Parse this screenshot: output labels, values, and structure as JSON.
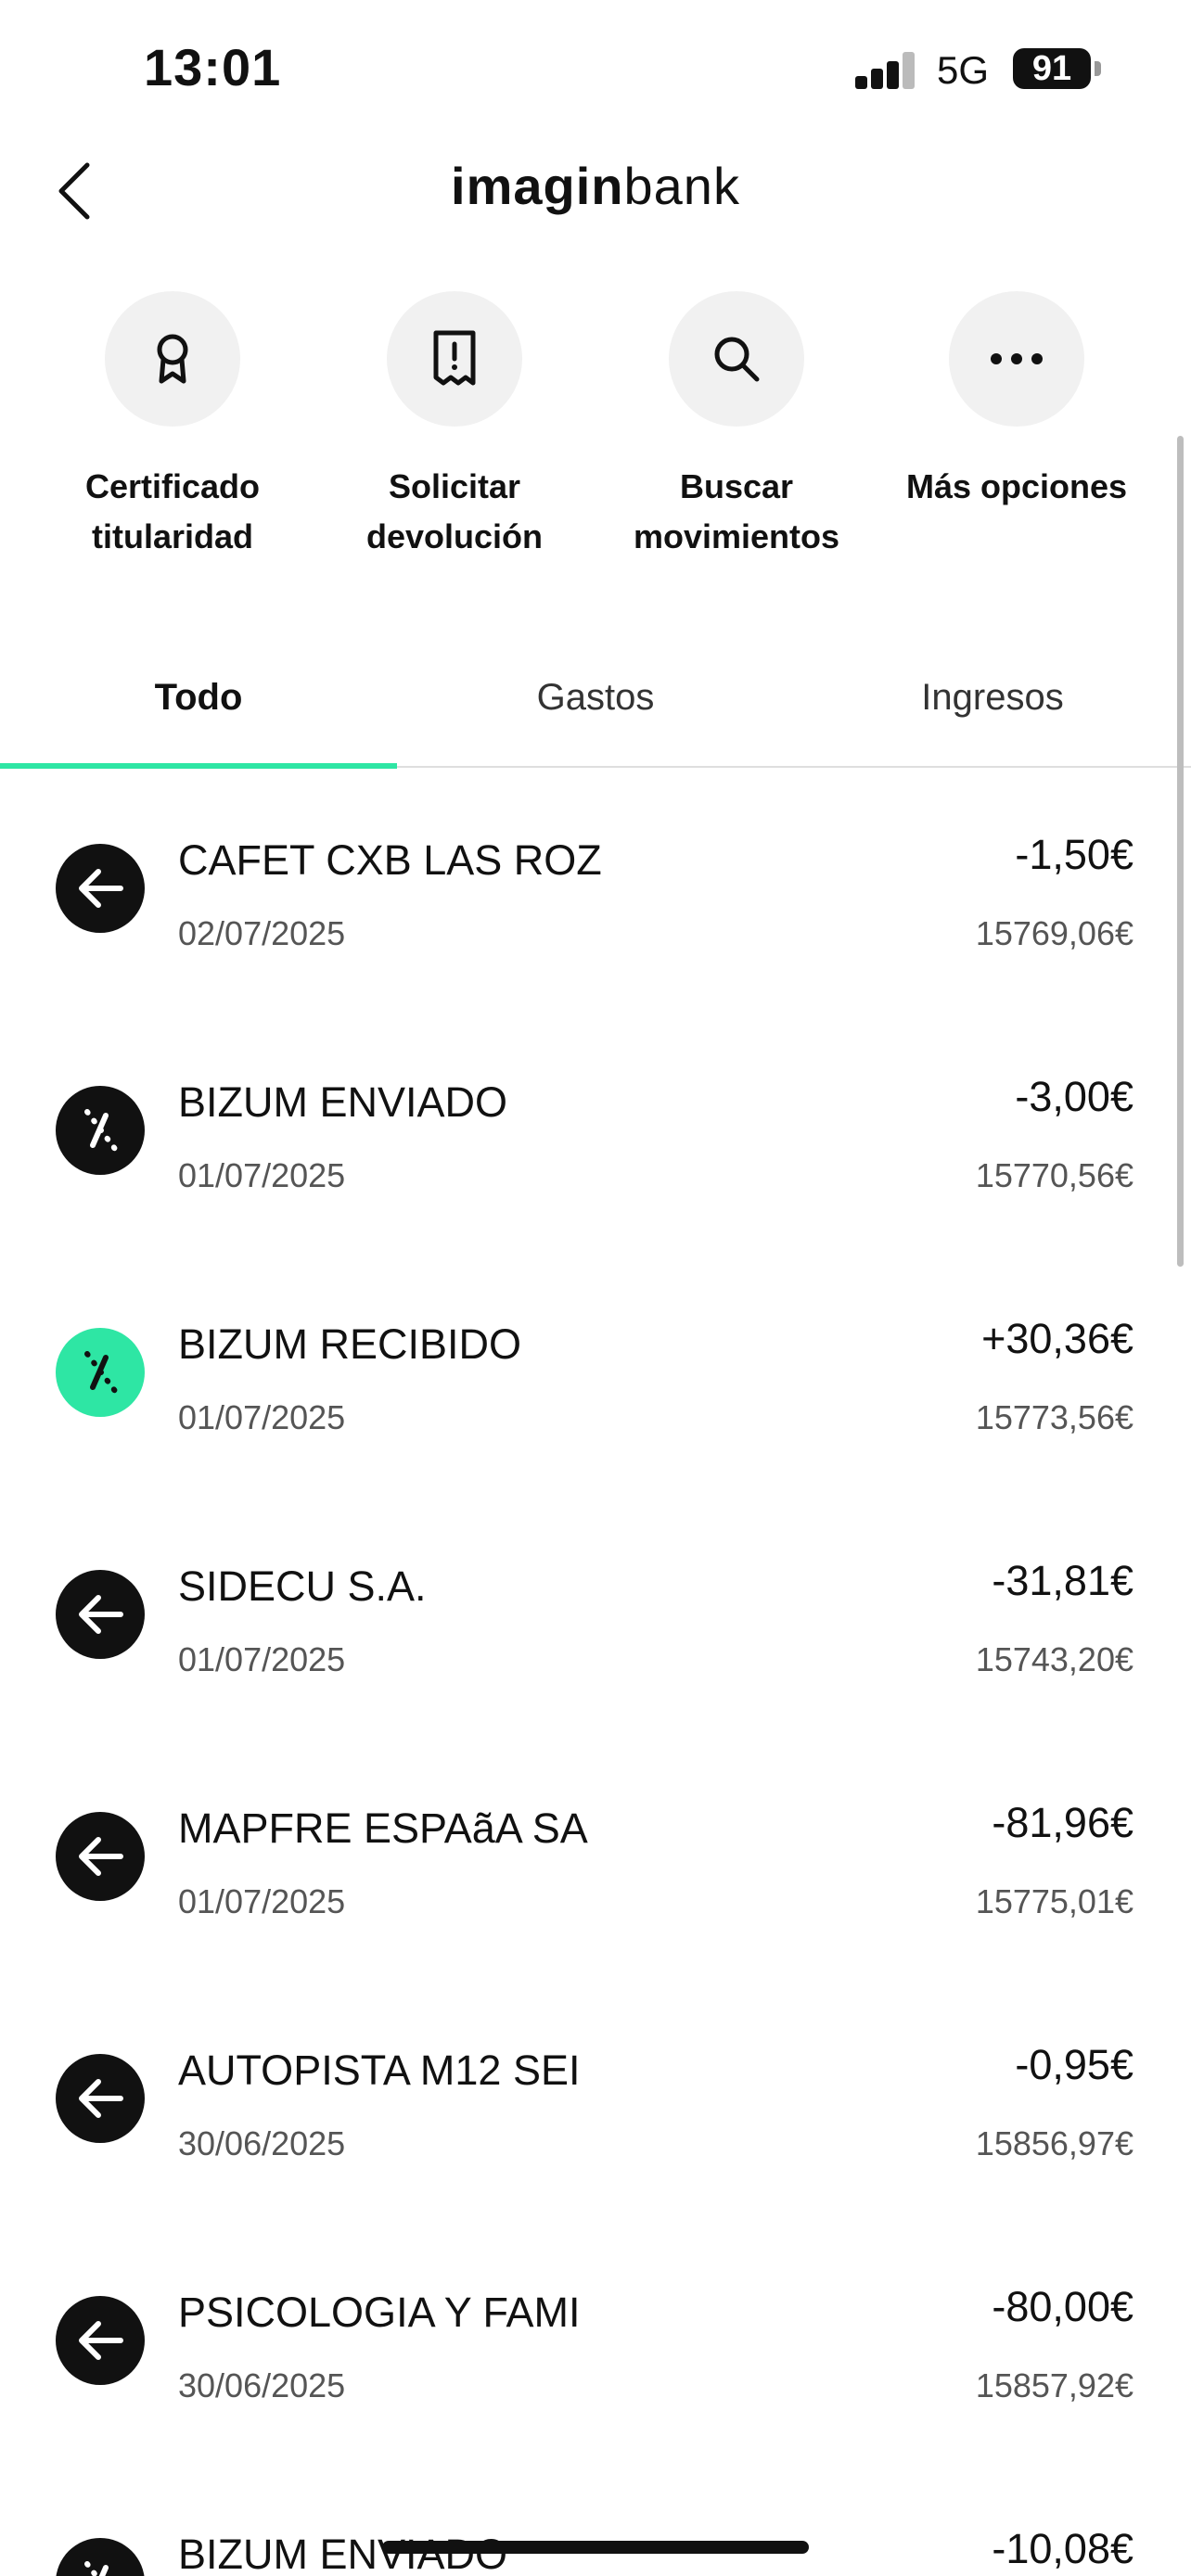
{
  "status_bar": {
    "time": "13:01",
    "network": "5G",
    "battery": "91"
  },
  "header": {
    "logo_bold": "imagin",
    "logo_light": "bank"
  },
  "actions": [
    {
      "label": "Certificado\ntitularidad",
      "icon": "ribbon-icon"
    },
    {
      "label": "Solicitar\ndevolución",
      "icon": "receipt-alert-icon"
    },
    {
      "label": "Buscar\nmovimientos",
      "icon": "search-icon"
    },
    {
      "label": "Más opciones",
      "icon": "more-icon"
    }
  ],
  "tabs": [
    {
      "label": "Todo",
      "active": true
    },
    {
      "label": "Gastos",
      "active": false
    },
    {
      "label": "Ingresos",
      "active": false
    }
  ],
  "colors": {
    "accent": "#2ee6a4",
    "icon_dark": "#111111"
  },
  "transactions": [
    {
      "name": "CAFET CXB LAS ROZ",
      "date": "02/07/2025",
      "amount": "-1,50€",
      "balance": "15769,06€",
      "icon": "arrow-left-icon",
      "color": "dark"
    },
    {
      "name": "BIZUM ENVIADO",
      "date": "01/07/2025",
      "amount": "-3,00€",
      "balance": "15770,56€",
      "icon": "bizum-icon",
      "color": "dark"
    },
    {
      "name": "BIZUM RECIBIDO",
      "date": "01/07/2025",
      "amount": "+30,36€",
      "balance": "15773,56€",
      "icon": "bizum-icon",
      "color": "green"
    },
    {
      "name": "SIDECU S.A.",
      "date": "01/07/2025",
      "amount": "-31,81€",
      "balance": "15743,20€",
      "icon": "arrow-left-icon",
      "color": "dark"
    },
    {
      "name": "MAPFRE ESPAãA SA",
      "date": "01/07/2025",
      "amount": "-81,96€",
      "balance": "15775,01€",
      "icon": "arrow-left-icon",
      "color": "dark"
    },
    {
      "name": "AUTOPISTA M12 SEI",
      "date": "30/06/2025",
      "amount": "-0,95€",
      "balance": "15856,97€",
      "icon": "arrow-left-icon",
      "color": "dark"
    },
    {
      "name": "PSICOLOGIA Y FAMI",
      "date": "30/06/2025",
      "amount": "-80,00€",
      "balance": "15857,92€",
      "icon": "arrow-left-icon",
      "color": "dark"
    },
    {
      "name": "BIZUM ENVIADO",
      "date": "",
      "amount": "-10,08€",
      "balance": "",
      "icon": "bizum-icon",
      "color": "dark"
    }
  ]
}
